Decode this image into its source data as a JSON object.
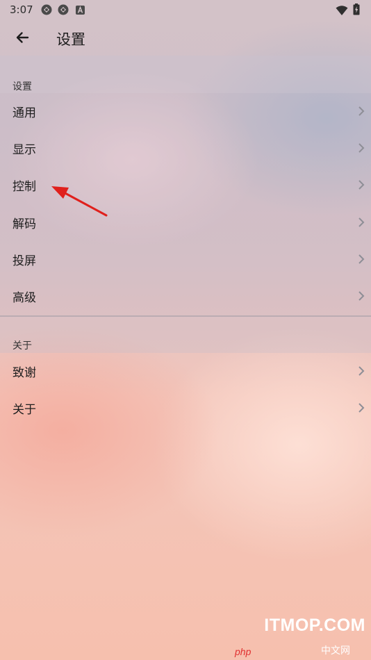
{
  "status_bar": {
    "time": "3:07",
    "left_icons": [
      "sync-icon",
      "sync-icon",
      "font-a-icon"
    ],
    "right_icons": [
      "wifi-icon",
      "battery-icon"
    ]
  },
  "app_bar": {
    "back_icon": "arrow-left-icon",
    "title": "设置"
  },
  "sections": [
    {
      "header": "设置",
      "items": [
        {
          "label": "通用"
        },
        {
          "label": "显示"
        },
        {
          "label": "控制"
        },
        {
          "label": "解码"
        },
        {
          "label": "投屏"
        },
        {
          "label": "高级"
        }
      ]
    },
    {
      "header": "关于",
      "items": [
        {
          "label": "致谢"
        },
        {
          "label": "关于"
        }
      ]
    }
  ],
  "annotation": {
    "color": "#e0201c",
    "icon": "red-arrow-icon"
  },
  "watermark": {
    "main": "ITMOP.COM",
    "php": "php",
    "sub": "中文网"
  }
}
